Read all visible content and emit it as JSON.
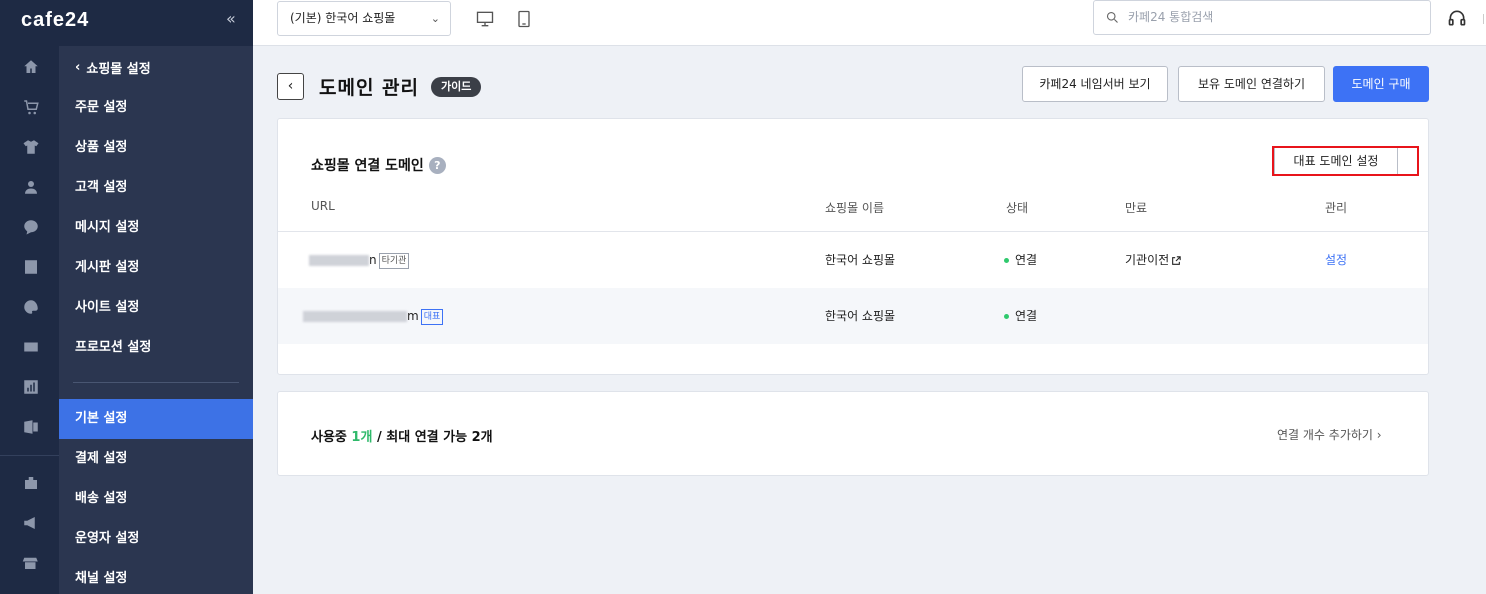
{
  "app": {
    "logo": "cafe24",
    "collapse_glyph": "«"
  },
  "rail_icons": [
    "home-icon",
    "cart-icon",
    "shirt-icon",
    "user-icon",
    "chat-icon",
    "board-icon",
    "palette-icon",
    "promo-icon",
    "stats-icon",
    "excel-icon",
    "store-icon",
    "megaphone-icon",
    "app-store-icon"
  ],
  "submenu": {
    "back_label": "쇼핑몰 설정",
    "items": [
      {
        "label": "주문 설정"
      },
      {
        "label": "상품 설정"
      },
      {
        "label": "고객 설정"
      },
      {
        "label": "메시지 설정"
      },
      {
        "label": "게시판 설정"
      },
      {
        "label": "사이트 설정"
      },
      {
        "label": "프로모션 설정"
      }
    ],
    "items2": [
      {
        "label": "기본 설정",
        "active": true
      },
      {
        "label": "결제 설정"
      },
      {
        "label": "배송 설정"
      },
      {
        "label": "운영자 설정"
      },
      {
        "label": "채널 설정"
      }
    ]
  },
  "topbar": {
    "shop_select": "(기본) 한국어 쇼핑몰",
    "search_placeholder": "카페24 통합검색"
  },
  "header": {
    "title": "도메인 관리",
    "guide_badge": "가이드",
    "btn_nameserver": "카페24 네임서버 보기",
    "btn_connect": "보유 도메인 연결하기",
    "btn_buy": "도메인 구매"
  },
  "domains": {
    "title": "쇼핑몰 연결 도메인",
    "help": "?",
    "rep_button": "대표 도메인 설정",
    "columns": {
      "url": "URL",
      "shop": "쇼핑몰 이름",
      "status": "상태",
      "expire": "만료",
      "manage": "관리"
    },
    "rows": [
      {
        "url_tail": "n",
        "tag": "타기관",
        "shop": "한국어 쇼핑몰",
        "status": "연결",
        "expire": "기관이전",
        "manage": "설정"
      },
      {
        "url_tail": "m",
        "tag": "대표",
        "shop": "한국어 쇼핑몰",
        "status": "연결",
        "expire": "",
        "manage": ""
      }
    ]
  },
  "usage": {
    "prefix": "사용중",
    "count": "1개",
    "suffix": "/ 최대 연결 가능 2개",
    "add_link": "연결 개수 추가하기"
  },
  "colors": {
    "accent": "#3d72f5",
    "sidebar": "#1e2a44",
    "submenu": "#2b3650",
    "highlight": "#e8141b",
    "status": "#2fc96d"
  }
}
